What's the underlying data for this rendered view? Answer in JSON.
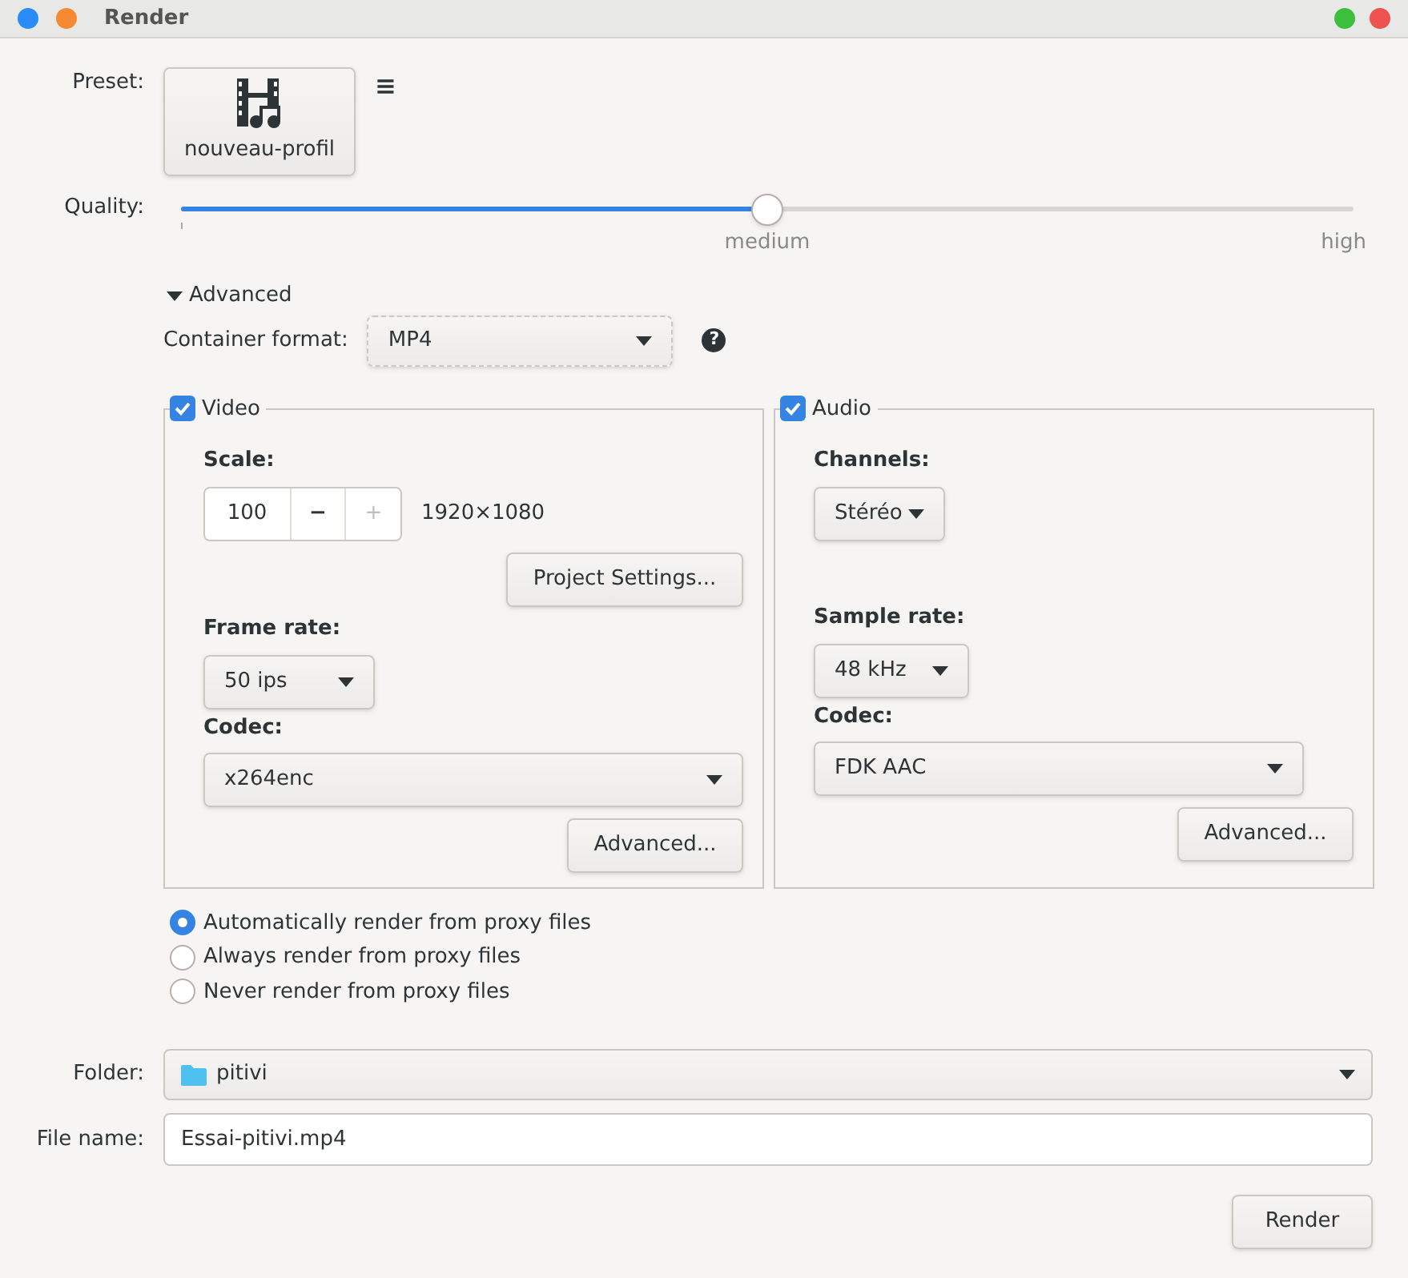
{
  "window": {
    "title": "Render"
  },
  "preset": {
    "label": "Preset:",
    "name": "nouveau-profil",
    "menu_glyph": "≡"
  },
  "quality": {
    "label": "Quality:",
    "level": 0.5,
    "marks": [
      "medium",
      "high"
    ]
  },
  "advanced": {
    "label": "Advanced",
    "expanded": true,
    "container_label": "Container format:",
    "container_value": "MP4",
    "help_glyph": "?"
  },
  "video": {
    "label": "Video",
    "checked": true,
    "scale_label": "Scale:",
    "scale_value": "100",
    "minus": "−",
    "plus": "+",
    "resolution": "1920×1080",
    "project_settings": "Project Settings...",
    "frame_rate_label": "Frame rate:",
    "frame_rate": "50 ips",
    "codec_label": "Codec:",
    "codec": "x264enc",
    "advanced_button": "Advanced..."
  },
  "audio": {
    "label": "Audio",
    "checked": true,
    "channels_label": "Channels:",
    "channels": "Stéréo",
    "sample_rate_label": "Sample rate:",
    "sample_rate": "48 kHz",
    "codec_label": "Codec:",
    "codec": "FDK AAC",
    "advanced_button": "Advanced..."
  },
  "proxy_options": [
    {
      "label": "Automatically render from proxy files",
      "selected": true
    },
    {
      "label": "Always render from proxy files",
      "selected": false
    },
    {
      "label": "Never render from proxy files",
      "selected": false
    }
  ],
  "folder": {
    "label": "Folder:",
    "value": "pitivi"
  },
  "file_name": {
    "label": "File name:",
    "value": "Essai-pitivi.mp4"
  },
  "render_button": "Render"
}
